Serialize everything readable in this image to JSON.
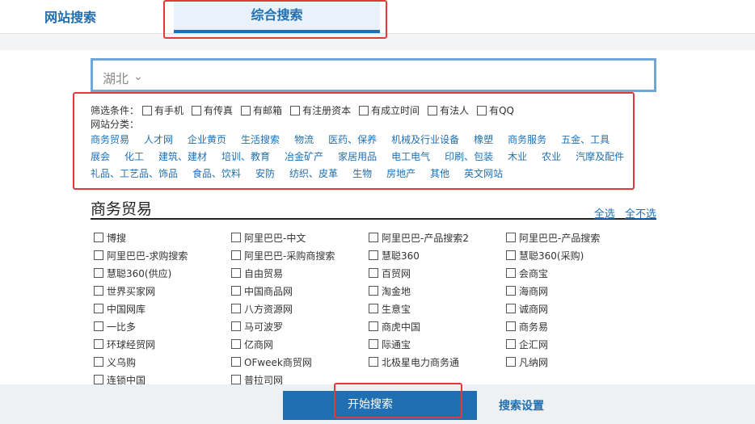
{
  "tabs": {
    "site_search": "网站搜索",
    "combined_search": "综合搜索"
  },
  "search": {
    "value": "湖北",
    "chevron": "⌄"
  },
  "filters": {
    "label": "筛选条件：",
    "options": [
      "有手机",
      "有传真",
      "有邮箱",
      "有注册资本",
      "有成立时间",
      "有法人",
      "有QQ"
    ]
  },
  "categories": {
    "label": "网站分类：",
    "rows": [
      [
        "商务贸易",
        "人才网",
        "企业黄页",
        "生活搜索",
        "物流",
        "医药、保养",
        "机械及行业设备",
        "橡塑",
        "商务服务",
        "五金、工具"
      ],
      [
        "展会",
        "化工",
        "建筑、建材",
        "培训、教育",
        "冶金矿产",
        "家居用品",
        "电工电气",
        "印刷、包装",
        "木业",
        "农业",
        "汽摩及配件"
      ],
      [
        "礼品、工艺品、饰品",
        "食品、饮料",
        "安防",
        "纺织、皮革",
        "生物",
        "房地产",
        "其他",
        "英文网站"
      ]
    ]
  },
  "section": {
    "title": "商务贸易",
    "select_all": "全选",
    "select_none": "全不选"
  },
  "sites": [
    [
      "博搜",
      "阿里巴巴-中文",
      "阿里巴巴-产品搜索2",
      "阿里巴巴-产品搜索"
    ],
    [
      "阿里巴巴-求购搜索",
      "阿里巴巴-采购商搜索",
      "慧聪360",
      "慧聪360(采购)"
    ],
    [
      "慧聪360(供应)",
      "自由贸易",
      "百贸网",
      "会商宝"
    ],
    [
      "世界买家网",
      "中国商品网",
      "淘金地",
      "海商网"
    ],
    [
      "中国网库",
      "八方资源网",
      "生意宝",
      "诚商网"
    ],
    [
      "一比多",
      "马可波罗",
      "商虎中国",
      "商务易"
    ],
    [
      "环球经贸网",
      "亿商网",
      "际通宝",
      "企汇网"
    ],
    [
      "义乌购",
      "OFweek商贸网",
      "北极星电力商务通",
      "凡纳网"
    ],
    [
      "连锁中国",
      "普拉司网"
    ]
  ],
  "actions": {
    "start_search": "开始搜索",
    "search_settings": "搜索设置"
  },
  "colors": {
    "accent": "#1f6fb2",
    "annotation": "#e23a3a"
  }
}
